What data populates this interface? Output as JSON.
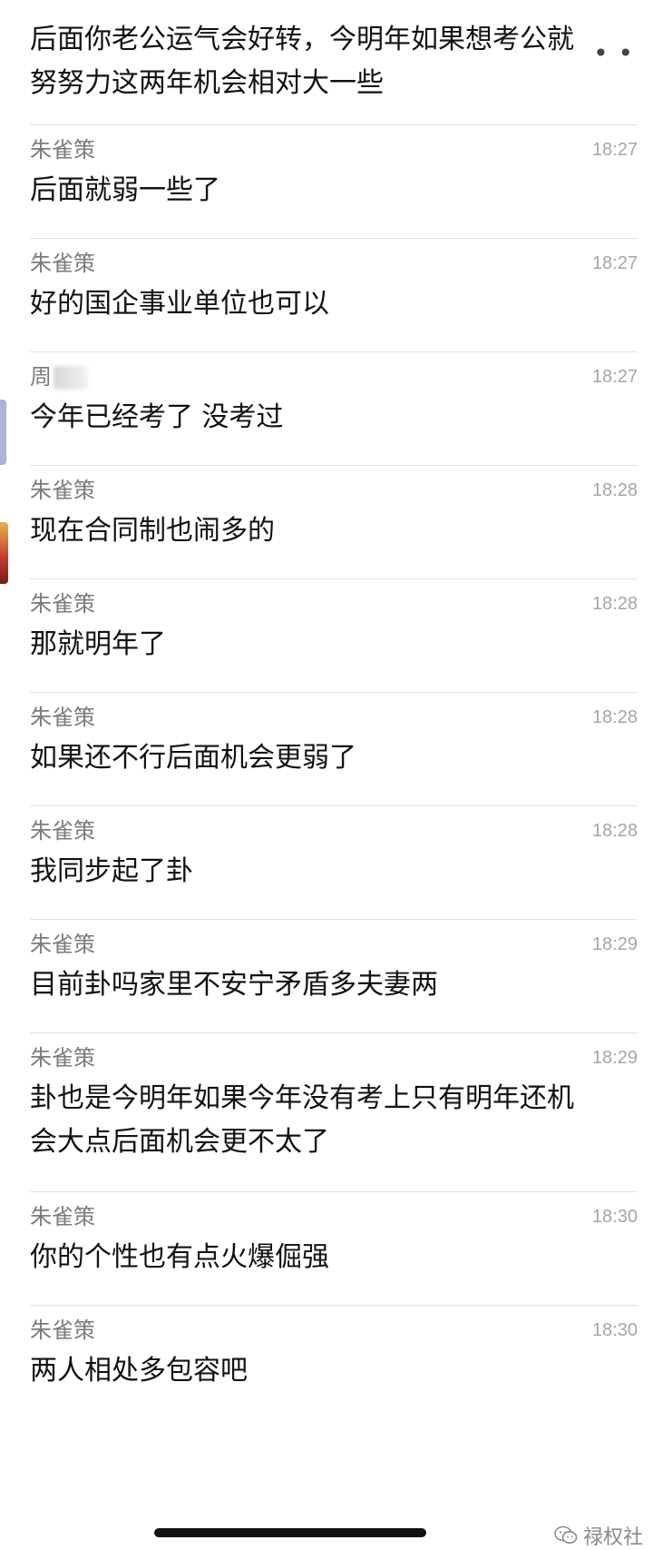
{
  "first_message": {
    "text": "后面你老公运气会好转，今明年如果想考公就\n努努力这两年机会相对大一些",
    "more_glyph": "• •"
  },
  "messages": [
    {
      "sender": "朱雀策",
      "time": "18:27",
      "text": "后面就弱一些了"
    },
    {
      "sender": "朱雀策",
      "time": "18:27",
      "text": "好的国企事业单位也可以"
    },
    {
      "sender": "周",
      "time": "18:27",
      "text": "今年已经考了 没考过"
    },
    {
      "sender": "朱雀策",
      "time": "18:28",
      "text": "现在合同制也闹多的"
    },
    {
      "sender": "朱雀策",
      "time": "18:28",
      "text": "那就明年了"
    },
    {
      "sender": "朱雀策",
      "time": "18:28",
      "text": "如果还不行后面机会更弱了"
    },
    {
      "sender": "朱雀策",
      "time": "18:28",
      "text": "我同步起了卦"
    },
    {
      "sender": "朱雀策",
      "time": "18:29",
      "text": "目前卦吗家里不安宁矛盾多夫妻两"
    },
    {
      "sender": "朱雀策",
      "time": "18:29",
      "text": "卦也是今明年如果今年没有考上只有明年还机\n会大点后面机会更不太了"
    },
    {
      "sender": "朱雀策",
      "time": "18:30",
      "text": "你的个性也有点火爆倔强"
    },
    {
      "sender": "朱雀策",
      "time": "18:30",
      "text": "两人相处多包容吧"
    }
  ],
  "watermark": {
    "label": "禄权社",
    "icon": "wechat-icon"
  },
  "colors": {
    "text": "#111111",
    "sender": "#7b7b7b",
    "time": "#a6a6a6",
    "divider": "#e2e2e2"
  }
}
